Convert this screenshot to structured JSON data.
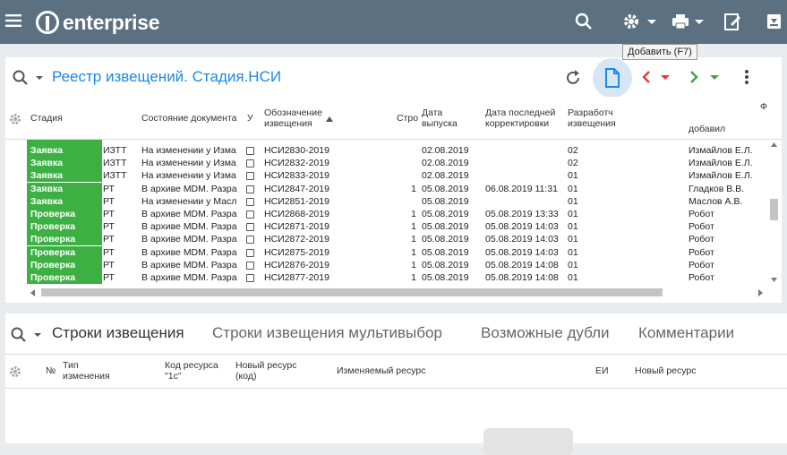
{
  "app": {
    "brand": "enterprise"
  },
  "topbar": {
    "icons": [
      "menu-icon",
      "search-icon",
      "gear-icon",
      "printer-icon",
      "edit-icon",
      "download-icon"
    ]
  },
  "registry": {
    "title": "Реестр извещений. Стадия.НСИ",
    "tooltip": "Добавить (F7)",
    "columns": [
      {
        "label": "Стадия"
      },
      {
        "label": "Состояние документа"
      },
      {
        "label": "У"
      },
      {
        "label": "Обозначение\nизвещения"
      },
      {
        "label": "Стро"
      },
      {
        "label": "Дата\nвыпуска"
      },
      {
        "label": "Дата последней\nкорректировки"
      },
      {
        "label": "Разработч\nизвещения"
      },
      {
        "label": "добавил"
      },
      {
        "label": "Ф"
      }
    ],
    "rows": [
      {
        "stage": "Заявка",
        "type": "ИЗТТ",
        "state": "На изменении у  Изма",
        "num": "НСИ2830-2019",
        "str": "",
        "date": "02.08.2019",
        "corr": "",
        "dev": "02",
        "author": "Измайлов Е.Л."
      },
      {
        "stage": "Заявка",
        "type": "ИЗТТ",
        "state": "На изменении у  Изма",
        "num": "НСИ2832-2019",
        "str": "",
        "date": "02.08.2019",
        "corr": "",
        "dev": "02",
        "author": "Измайлов Е.Л."
      },
      {
        "stage": "Заявка",
        "type": "ИЗТТ",
        "state": "На изменении у  Изма",
        "num": "НСИ2833-2019",
        "str": "",
        "date": "02.08.2019",
        "corr": "",
        "dev": "01",
        "author": "Измайлов Е.Л."
      },
      {
        "stage": "Заявка",
        "type": "РТ",
        "state": "В архиве MDM. Разра",
        "num": "НСИ2847-2019",
        "str": "1",
        "date": "05.08.2019",
        "corr": "06.08.2019 11:31",
        "dev": "01",
        "author": "Гладков В.В."
      },
      {
        "stage": "Заявка",
        "type": "РТ",
        "state": "На изменении у  Масл",
        "num": "НСИ2851-2019",
        "str": "",
        "date": "05.08.2019",
        "corr": "",
        "dev": "01",
        "author": "Маслов А.В."
      },
      {
        "stage": "Проверка",
        "type": "РТ",
        "state": "В архиве MDM. Разра",
        "num": "НСИ2868-2019",
        "str": "1",
        "date": "05.08.2019",
        "corr": "05.08.2019 13:33",
        "dev": "01",
        "author": "Робот"
      },
      {
        "stage": "Проверка",
        "type": "РТ",
        "state": "В архиве MDM. Разра",
        "num": "НСИ2871-2019",
        "str": "1",
        "date": "05.08.2019",
        "corr": "05.08.2019 14:03",
        "dev": "01",
        "author": "Робот"
      },
      {
        "stage": "Проверка",
        "type": "РТ",
        "state": "В архиве MDM. Разра",
        "num": "НСИ2872-2019",
        "str": "1",
        "date": "05.08.2019",
        "corr": "05.08.2019 14:03",
        "dev": "01",
        "author": "Робот"
      },
      {
        "stage": "Проверка",
        "type": "РТ",
        "state": "В архиве MDM. Разра",
        "num": "НСИ2875-2019",
        "str": "1",
        "date": "05.08.2019",
        "corr": "05.08.2019 14:03",
        "dev": "01",
        "author": "Робот"
      },
      {
        "stage": "Проверка",
        "type": "РТ",
        "state": "В архиве MDM. Разра",
        "num": "НСИ2876-2019",
        "str": "1",
        "date": "05.08.2019",
        "corr": "05.08.2019 14:08",
        "dev": "01",
        "author": "Робот"
      },
      {
        "stage": "Проверка",
        "type": "РТ",
        "state": "В архиве MDM. Разра",
        "num": "НСИ2877-2019",
        "str": "1",
        "date": "05.08.2019",
        "corr": "05.08.2019 14:08",
        "dev": "01",
        "author": "Робот"
      }
    ]
  },
  "lines": {
    "tabs": [
      "Строки извещения",
      "Строки извещения мультивыбор",
      "Возможные дубли",
      "Комментарии"
    ],
    "columns": [
      "№",
      "Тип\nизменения",
      "Код ресурса\n\"1с\"",
      "Новый ресурс\n(код)",
      "Изменяемый ресурс",
      "ЕИ",
      "Новый ресурс"
    ]
  }
}
